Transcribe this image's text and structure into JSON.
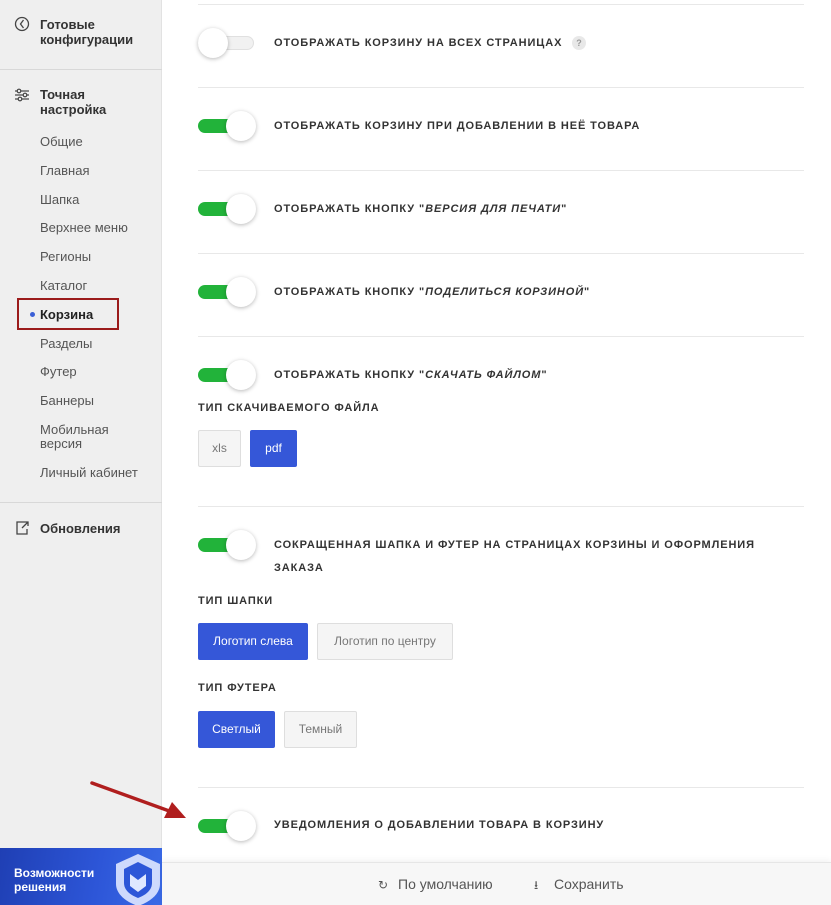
{
  "sidebar": {
    "ready_configs": "Готовые\nконфигурации",
    "fine_tuning": "Точная\nнастройка",
    "items": [
      {
        "label": "Общие"
      },
      {
        "label": "Главная"
      },
      {
        "label": "Шапка"
      },
      {
        "label": "Верхнее меню"
      },
      {
        "label": "Регионы"
      },
      {
        "label": "Каталог"
      },
      {
        "label": "Корзина",
        "active": true
      },
      {
        "label": "Разделы"
      },
      {
        "label": "Футер"
      },
      {
        "label": "Баннеры"
      },
      {
        "label": "Мобильная\nверсия"
      },
      {
        "label": "Личный кабинет"
      }
    ],
    "updates": "Обновления",
    "promo": "Возможности\nрешения"
  },
  "options": [
    {
      "label": "Отображать корзину на всех страницах",
      "state": "off",
      "help": "?"
    },
    {
      "label": "Отображать корзину при добавлении в неё товара",
      "state": "on"
    },
    {
      "label_prefix": "Отображать кнопку \"",
      "label_italic": "Версия для печати",
      "label_suffix": "\"",
      "state": "on"
    },
    {
      "label_prefix": "Отображать кнопку \"",
      "label_italic": "Поделиться корзиной",
      "label_suffix": "\"",
      "state": "on"
    },
    {
      "label_prefix": "Отображать кнопку \"",
      "label_italic": "Скачать файлом",
      "label_suffix": "\"",
      "state": "on"
    },
    {
      "label": "Сокращенная шапка и футер на страницах корзины и оформления заказа",
      "state": "on"
    },
    {
      "label": "Уведомления о добавлении товара в корзину",
      "state": "on"
    }
  ],
  "file_type": {
    "label": "ТИП СКАЧИВАЕМОГО ФАЙЛА",
    "options": [
      "xls",
      "pdf"
    ],
    "selected": "pdf"
  },
  "header_type": {
    "label": "ТИП ШАПКИ",
    "options": [
      "Логотип слева",
      "Логотип по центру"
    ],
    "selected": "Логотип слева"
  },
  "footer_type": {
    "label": "ТИП ФУТЕРА",
    "options": [
      "Светлый",
      "Темный"
    ],
    "selected": "Светлый"
  },
  "footer_bar": {
    "reset": "По умолчанию",
    "save": "Сохранить"
  },
  "colors": {
    "toggle_on": "#22b33a",
    "accent_blue": "#3557d8",
    "highlight_box": "#9b1b1b",
    "arrow": "#b01e1e"
  },
  "icons": {
    "ready_configs": "compass-icon",
    "fine_tuning": "sliders-icon",
    "updates": "export-icon",
    "reset": "refresh-icon",
    "save": "download-icon"
  }
}
